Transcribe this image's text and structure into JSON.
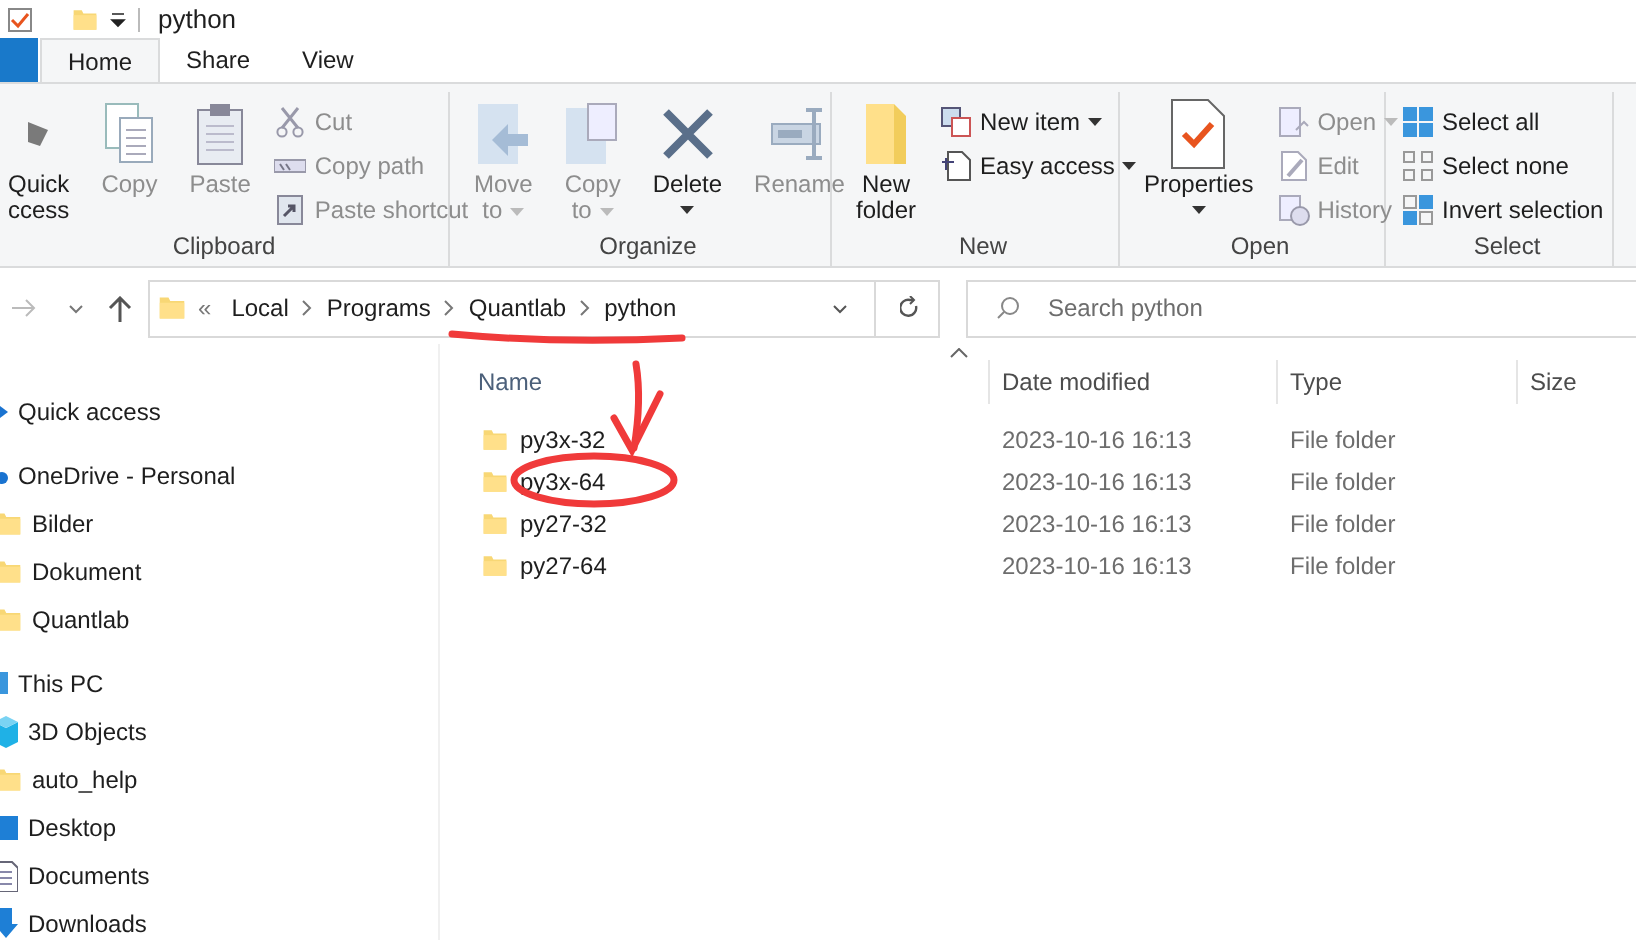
{
  "window": {
    "title": "python"
  },
  "tabs": [
    {
      "label": "Home",
      "selected": true
    },
    {
      "label": "Share",
      "selected": false
    },
    {
      "label": "View",
      "selected": false
    }
  ],
  "ribbon": {
    "groups": [
      {
        "label": "Clipboard",
        "items": [
          {
            "kind": "large",
            "lines": [
              "Quick",
              "ccess"
            ],
            "disabled": false,
            "dropdown": false
          },
          {
            "kind": "large",
            "lines": [
              "Copy"
            ],
            "disabled": true,
            "dropdown": false
          },
          {
            "kind": "large",
            "lines": [
              "Paste"
            ],
            "disabled": true,
            "dropdown": false
          },
          {
            "kind": "small",
            "label": "Cut",
            "disabled": true,
            "dropdown": false
          },
          {
            "kind": "small",
            "label": "Copy path",
            "disabled": true,
            "dropdown": false
          },
          {
            "kind": "small",
            "label": "Paste shortcut",
            "disabled": true,
            "dropdown": false
          }
        ]
      },
      {
        "label": "Organize",
        "items": [
          {
            "kind": "large",
            "lines": [
              "Move",
              "to"
            ],
            "disabled": true,
            "dropdown": true
          },
          {
            "kind": "large",
            "lines": [
              "Copy",
              "to"
            ],
            "disabled": true,
            "dropdown": true
          },
          {
            "kind": "large",
            "lines": [
              "Delete"
            ],
            "disabled": false,
            "dropdown": true
          },
          {
            "kind": "large",
            "lines": [
              "Rename"
            ],
            "disabled": true,
            "dropdown": false
          }
        ]
      },
      {
        "label": "New",
        "items": [
          {
            "kind": "large",
            "lines": [
              "New",
              "folder"
            ],
            "disabled": false,
            "dropdown": false
          },
          {
            "kind": "small",
            "label": "New item",
            "disabled": false,
            "dropdown": true
          },
          {
            "kind": "small",
            "label": "Easy access",
            "disabled": false,
            "dropdown": true
          }
        ]
      },
      {
        "label": "Open",
        "items": [
          {
            "kind": "large",
            "lines": [
              "Properties"
            ],
            "disabled": false,
            "dropdown": true
          },
          {
            "kind": "small",
            "label": "Open",
            "disabled": true,
            "dropdown": true
          },
          {
            "kind": "small",
            "label": "Edit",
            "disabled": true,
            "dropdown": false
          },
          {
            "kind": "small",
            "label": "History",
            "disabled": true,
            "dropdown": false
          }
        ]
      },
      {
        "label": "Select",
        "items": [
          {
            "kind": "small",
            "label": "Select all",
            "disabled": false,
            "dropdown": false
          },
          {
            "kind": "small",
            "label": "Select none",
            "disabled": false,
            "dropdown": false
          },
          {
            "kind": "small",
            "label": "Invert selection",
            "disabled": false,
            "dropdown": false
          }
        ]
      }
    ]
  },
  "address_bar": {
    "overflow": "«",
    "crumbs": [
      "Local",
      "Programs",
      "Quantlab",
      "python"
    ]
  },
  "search": {
    "placeholder": "Search python"
  },
  "navigation": [
    {
      "label": "Quick access"
    },
    {
      "label": "OneDrive - Personal",
      "children": [
        {
          "label": "Bilder"
        },
        {
          "label": "Dokument"
        },
        {
          "label": "Quantlab"
        }
      ]
    },
    {
      "label": "This PC",
      "children": [
        {
          "label": "3D Objects"
        },
        {
          "label": "auto_help"
        },
        {
          "label": "Desktop"
        },
        {
          "label": "Documents"
        },
        {
          "label": "Downloads"
        }
      ]
    }
  ],
  "table": {
    "columns": [
      "Name",
      "Date modified",
      "Type",
      "Size"
    ],
    "rows": [
      {
        "name": "py3x-32",
        "date": "2023-10-16 16:13",
        "type": "File folder"
      },
      {
        "name": "py3x-64",
        "date": "2023-10-16 16:13",
        "type": "File folder"
      },
      {
        "name": "py27-32",
        "date": "2023-10-16 16:13",
        "type": "File folder"
      },
      {
        "name": "py27-64",
        "date": "2023-10-16 16:13",
        "type": "File folder"
      }
    ]
  },
  "annotations": [
    {
      "kind": "underline"
    },
    {
      "kind": "arrow"
    },
    {
      "kind": "circle"
    }
  ]
}
